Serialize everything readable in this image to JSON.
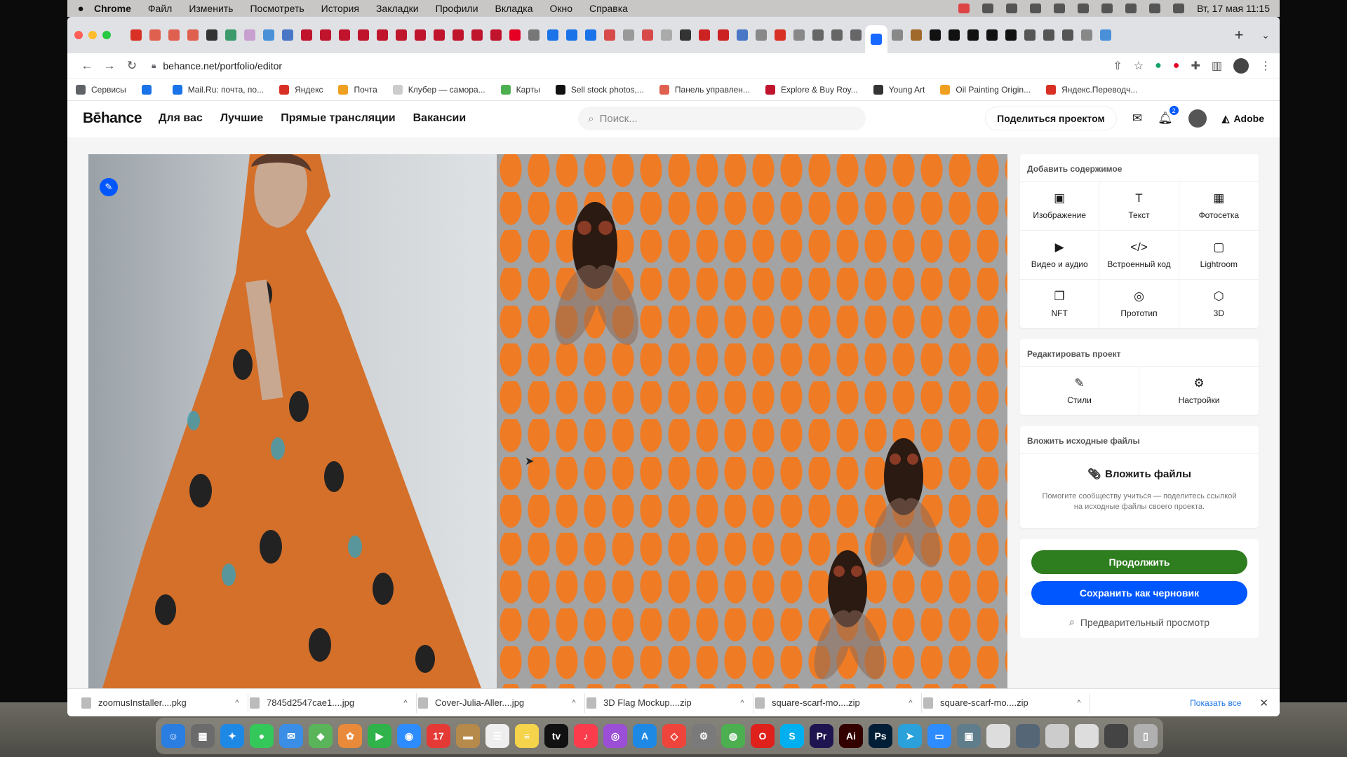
{
  "menubar": {
    "app": "Chrome",
    "items": [
      "Файл",
      "Изменить",
      "Посмотреть",
      "История",
      "Закладки",
      "Профили",
      "Вкладка",
      "Окно",
      "Справка"
    ],
    "clock": "Вт, 17 мая  11:15"
  },
  "browser": {
    "url": "behance.net/portfolio/editor",
    "tab_colors": [
      "#d93025",
      "#e06050",
      "#e06050",
      "#e06050",
      "#333333",
      "#3c9a6b",
      "#c8a0d0",
      "#4a90d9",
      "#4a76c6",
      "#c0142c",
      "#c0142c",
      "#c0142c",
      "#c0142c",
      "#c0142c",
      "#c0142c",
      "#c0142c",
      "#c0142c",
      "#c0142c",
      "#c0142c",
      "#c0142c",
      "#e60023",
      "#777777",
      "#1a73e8",
      "#1a73e8",
      "#1a73e8",
      "#d84a4a",
      "#999999",
      "#d84a4a",
      "#aaaaaa",
      "#333333",
      "#cc2222",
      "#cc2222",
      "#4a76c6",
      "#888888",
      "#d93025",
      "#888888",
      "#666666",
      "#666666",
      "#666666",
      "#1769ff",
      "#888888",
      "#a06a2a",
      "#111111",
      "#111111",
      "#111111",
      "#111111",
      "#111111",
      "#555555",
      "#555555",
      "#555555",
      "#888888",
      "#4a90d9"
    ],
    "bookmarks": [
      {
        "label": "Сервисы",
        "color": "#5f6368"
      },
      {
        "label": "",
        "color": "#1a73e8"
      },
      {
        "label": "Mail.Ru: почта, по...",
        "color": "#1a73e8"
      },
      {
        "label": "Яндекс",
        "color": "#d93025"
      },
      {
        "label": "Почта",
        "color": "#f0a020"
      },
      {
        "label": "Клубер — самора...",
        "color": "#cccccc"
      },
      {
        "label": "Карты",
        "color": "#4caf50"
      },
      {
        "label": "Sell stock photos,...",
        "color": "#111111"
      },
      {
        "label": "Панель управлен...",
        "color": "#e06050"
      },
      {
        "label": "Explore & Buy Roy...",
        "color": "#c0142c"
      },
      {
        "label": "Young Art",
        "color": "#333333"
      },
      {
        "label": "Oil Painting Origin...",
        "color": "#f0a020"
      },
      {
        "label": "Яндекс.Переводч...",
        "color": "#d93025"
      }
    ]
  },
  "behance": {
    "logo": "Bēhance",
    "nav": [
      "Для вас",
      "Лучшие",
      "Прямые трансляции",
      "Вакансии"
    ],
    "search_placeholder": "Поиск...",
    "share_button": "Поделиться проектом",
    "notifications_count": "2",
    "adobe": "Adobe"
  },
  "sidebar": {
    "add_content_title": "Добавить содержимое",
    "add_tools": [
      {
        "label": "Изображение",
        "icon": "image-icon"
      },
      {
        "label": "Текст",
        "icon": "text-icon"
      },
      {
        "label": "Фотосетка",
        "icon": "photo-grid-icon"
      },
      {
        "label": "Видео и аудио",
        "icon": "video-audio-icon"
      },
      {
        "label": "Встроенный код",
        "icon": "embed-code-icon"
      },
      {
        "label": "Lightroom",
        "icon": "lightroom-icon"
      },
      {
        "label": "NFT",
        "icon": "nft-icon"
      },
      {
        "label": "Прототип",
        "icon": "prototype-icon"
      },
      {
        "label": "3D",
        "icon": "3d-icon"
      }
    ],
    "edit_project_title": "Редактировать проект",
    "edit_tools": [
      {
        "label": "Стили",
        "icon": "brush-icon"
      },
      {
        "label": "Настройки",
        "icon": "gear-icon"
      }
    ],
    "attach_title": "Вложить исходные файлы",
    "attach_button": "Вложить файлы",
    "attach_hint": "Помогите сообществу учиться — поделитесь ссылкой на исходные файлы своего проекта.",
    "continue_button": "Продолжить",
    "save_draft_button": "Сохранить как черновик",
    "preview_link": "Предварительный просмотр"
  },
  "downloads": {
    "items": [
      "zoomusInstaller....pkg",
      "7845d2547cae1....jpg",
      "Cover-Julia-Aller....jpg",
      "3D Flag Mockup....zip",
      "square-scarf-mo....zip",
      "square-scarf-mo....zip"
    ],
    "show_all": "Показать все"
  },
  "dock": {
    "apps": [
      {
        "name": "Finder",
        "glyph": "☺",
        "color": "#2a7de1"
      },
      {
        "name": "Launchpad",
        "glyph": "▦",
        "color": "#6b6b6b"
      },
      {
        "name": "Safari",
        "glyph": "✦",
        "color": "#1e88e5"
      },
      {
        "name": "Messages",
        "glyph": "●",
        "color": "#34c759"
      },
      {
        "name": "Mail",
        "glyph": "✉",
        "color": "#3a8ee6"
      },
      {
        "name": "Maps",
        "glyph": "◆",
        "color": "#5ab55a"
      },
      {
        "name": "Photos",
        "glyph": "✿",
        "color": "#e88a3a"
      },
      {
        "name": "FaceTime",
        "glyph": "▶",
        "color": "#2fb34a"
      },
      {
        "name": "Zoom",
        "glyph": "◉",
        "color": "#2d8cff"
      },
      {
        "name": "Calendar",
        "glyph": "17",
        "color": "#e53935"
      },
      {
        "name": "Folder",
        "glyph": "▬",
        "color": "#b58a4a"
      },
      {
        "name": "Reminders",
        "glyph": "☰",
        "color": "#eeeeee"
      },
      {
        "name": "Notes",
        "glyph": "≡",
        "color": "#f5d34a"
      },
      {
        "name": "TV",
        "glyph": "tv",
        "color": "#111111"
      },
      {
        "name": "Music",
        "glyph": "♪",
        "color": "#fa3c4c"
      },
      {
        "name": "Podcasts",
        "glyph": "◎",
        "color": "#9b4fd6"
      },
      {
        "name": "App Store",
        "glyph": "A",
        "color": "#1e88e5"
      },
      {
        "name": "AnyDesk",
        "glyph": "◇",
        "color": "#ef443b"
      },
      {
        "name": "System Preferences",
        "glyph": "⚙",
        "color": "#7a7a7a"
      },
      {
        "name": "Chrome",
        "glyph": "◍",
        "color": "#4caf50"
      },
      {
        "name": "Opera",
        "glyph": "O",
        "color": "#e0201b"
      },
      {
        "name": "Skype",
        "glyph": "S",
        "color": "#00aff0"
      },
      {
        "name": "Premiere Pro",
        "glyph": "Pr",
        "color": "#1e1450"
      },
      {
        "name": "Illustrator",
        "glyph": "Ai",
        "color": "#330000"
      },
      {
        "name": "Photoshop",
        "glyph": "Ps",
        "color": "#001e36"
      },
      {
        "name": "Telegram",
        "glyph": "➤",
        "color": "#2aa1da"
      },
      {
        "name": "Zoom Meetings",
        "glyph": "▭",
        "color": "#2d8cff"
      },
      {
        "name": "Preview",
        "glyph": "▣",
        "color": "#607d8b"
      },
      {
        "name": "Window 1",
        "glyph": "",
        "color": "#dddddd"
      },
      {
        "name": "Window 2",
        "glyph": "",
        "color": "#556677"
      },
      {
        "name": "Window 3",
        "glyph": "",
        "color": "#cccccc"
      },
      {
        "name": "Window 4",
        "glyph": "",
        "color": "#dddddd"
      },
      {
        "name": "Window 5",
        "glyph": "",
        "color": "#444444"
      },
      {
        "name": "Trash",
        "glyph": "▯",
        "color": "#b0b0b0"
      }
    ]
  }
}
